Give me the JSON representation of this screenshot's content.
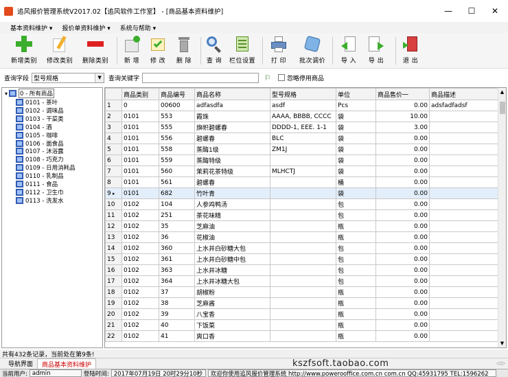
{
  "window": {
    "title": "追风报价管理系统V2017.02【追风软件工作室】 - [商品基本资料维护]"
  },
  "menu": [
    "基本资料维护 ▾",
    "报价单资料维护 ▾",
    "系统与帮助 ▾"
  ],
  "toolbar": {
    "add_category": "新增类别",
    "edit_category": "修改类别",
    "delete_category": "删除类别",
    "add": "新 增",
    "edit": "修 改",
    "delete": "删 除",
    "query": "查 询",
    "column_settings": "栏位设置",
    "print": "打 印",
    "batch_price": "批次调价",
    "import": "导 入",
    "export": "导 出",
    "exit": "退 出"
  },
  "query": {
    "field_label": "查询字段",
    "field_value": "型号规格",
    "keyword_label": "查询关键字",
    "keyword_value": "",
    "ignore_disabled": "忽略停用商品"
  },
  "tree": {
    "root": "0 - 所有商品",
    "items": [
      "0101 - 茶叶",
      "0102 - 调味品",
      "0103 - 干菜类",
      "0104 - 酒",
      "0105 - 咖啡",
      "0106 - 面食品",
      "0107 - 沐浴露",
      "0108 - 巧克力",
      "0109 - 日用消耗品",
      "0110 - 乳制品",
      "0111 - 食品",
      "0112 - 卫生巾",
      "0113 - 洗发水"
    ]
  },
  "grid": {
    "columns": [
      "商品类别",
      "商品编号",
      "商品名称",
      "型号规格",
      "单位",
      "商品售价一",
      "商品描述"
    ],
    "rows": [
      [
        "1",
        "0",
        "00600",
        "adfasdfa",
        "asdf",
        "Pcs",
        "0.00",
        "adsfadfadsf"
      ],
      [
        "2",
        "0101",
        "553",
        "霞珠",
        "AAAA, BBBB, CCCC",
        "袋",
        "10.00",
        ""
      ],
      [
        "3",
        "0101",
        "555",
        "旗帜碧螺春",
        "DDDD-1, EEE. 1-1",
        "袋",
        "3.00",
        ""
      ],
      [
        "4",
        "0101",
        "556",
        "碧螺春",
        "BLC",
        "袋",
        "0.00",
        ""
      ],
      [
        "5",
        "0101",
        "558",
        "蒸酶1级",
        "ZM1J",
        "袋",
        "0.00",
        ""
      ],
      [
        "6",
        "0101",
        "559",
        "蒸酶特级",
        "",
        "袋",
        "0.00",
        ""
      ],
      [
        "7",
        "0101",
        "560",
        "茉莉花茶特级",
        "MLHCTJ",
        "袋",
        "0.00",
        ""
      ],
      [
        "8",
        "0101",
        "561",
        "碧螺春",
        "",
        "桶",
        "0.00",
        ""
      ],
      [
        "9",
        "0101",
        "682",
        "竹叶青",
        "",
        "袋",
        "0.00",
        ""
      ],
      [
        "10",
        "0102",
        "104",
        "人参鸡鸭汤",
        "",
        "包",
        "0.00",
        ""
      ],
      [
        "11",
        "0102",
        "251",
        "茶花味精",
        "",
        "包",
        "0.00",
        ""
      ],
      [
        "12",
        "0102",
        "35",
        "芝麻油",
        "",
        "瓶",
        "0.00",
        ""
      ],
      [
        "13",
        "0102",
        "36",
        "花椒油",
        "",
        "瓶",
        "0.00",
        ""
      ],
      [
        "14",
        "0102",
        "360",
        "上水井白砂糖大包",
        "",
        "包",
        "0.00",
        ""
      ],
      [
        "15",
        "0102",
        "361",
        "上水井白砂糖中包",
        "",
        "包",
        "0.00",
        ""
      ],
      [
        "16",
        "0102",
        "363",
        "上水井冰糖",
        "",
        "包",
        "0.00",
        ""
      ],
      [
        "17",
        "0102",
        "364",
        "上水井冰糖大包",
        "",
        "包",
        "0.00",
        ""
      ],
      [
        "18",
        "0102",
        "37",
        "胡椒粉",
        "",
        "瓶",
        "0.00",
        ""
      ],
      [
        "19",
        "0102",
        "38",
        "芝麻酱",
        "",
        "瓶",
        "0.00",
        ""
      ],
      [
        "20",
        "0102",
        "39",
        "八宝香",
        "",
        "瓶",
        "0.00",
        ""
      ],
      [
        "21",
        "0102",
        "40",
        "下饭菜",
        "",
        "瓶",
        "0.00",
        ""
      ],
      [
        "22",
        "0102",
        "41",
        "爽口香",
        "",
        "瓶",
        "0.00",
        ""
      ]
    ],
    "selected_row": 8
  },
  "status": {
    "record_info": "共有432条记录，当前处在第9条!"
  },
  "tabs": [
    "导航界面",
    "商品基本资料维护"
  ],
  "watermark": "kszfsoft.taobao.com",
  "bottom": {
    "user_label": "当前用户:",
    "user_value": "admin",
    "time_label": "登陆时间:",
    "time_value": "2017年07月19日 20时29分10秒",
    "welcome": "欢迎你使用追风报价管理系统 http://www.powerooffice.com.cn com.cn QQ:45931795 TEL:1596262"
  },
  "colors": {
    "active_tab": "#cc0000",
    "selected_row": "#e3eefb"
  }
}
